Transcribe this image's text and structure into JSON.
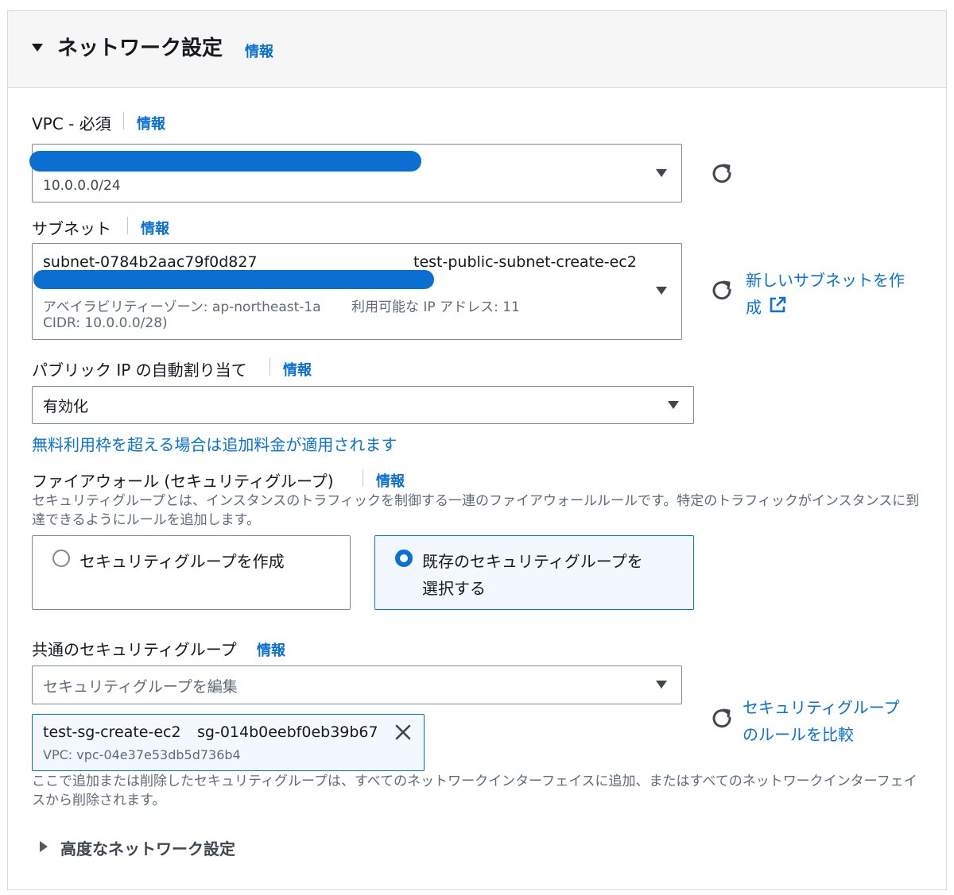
{
  "header": {
    "title": "ネットワーク設定",
    "info": "情報"
  },
  "vpc": {
    "label": "VPC - 必須",
    "info": "情報",
    "cidr": "10.0.0.0/24"
  },
  "subnet": {
    "label": "サブネット",
    "info": "情報",
    "id": "subnet-0784b2aac79f0d827",
    "name": "test-public-subnet-create-ec2",
    "az": "アベイラビリティーゾーン: ap-northeast-1a",
    "ip_available": "利用可能な IP アドレス: 11",
    "cidr": "CIDR: 10.0.0.0/28)",
    "create_link_line1": "新しいサブネットを作",
    "create_link_line2": "成"
  },
  "public_ip": {
    "label": "パブリック IP の自動割り当て",
    "info": "情報",
    "value": "有効化",
    "warning": "無料利用枠を超える場合は追加料金が適用されます"
  },
  "firewall": {
    "label": "ファイアウォール (セキュリティグループ)",
    "info": "情報",
    "description": "セキュリティグループとは、インスタンスのトラフィックを制御する一連のファイアウォールルールです。特定のトラフィックがインスタンスに到達できるようにルールを追加します。",
    "option_create": "セキュリティグループを作成",
    "option_existing_line1": "既存のセキュリティグループを",
    "option_existing_line2": "選択する",
    "selected": "existing"
  },
  "common_sg": {
    "label": "共通のセキュリティグループ",
    "info": "情報",
    "placeholder": "セキュリティグループを編集",
    "token_name": "test-sg-create-ec2",
    "token_id": "sg-014b0eebf0eb39b67",
    "token_vpc": "VPC: vpc-04e37e53db5d736b4",
    "compare_link_line1": "セキュリティグループ",
    "compare_link_line2": "のルールを比較",
    "note": "ここで追加または削除したセキュリティグループは、すべてのネットワークインターフェイスに追加、またはすべてのネットワークインターフェイスから削除されます。"
  },
  "advanced": {
    "label": "高度なネットワーク設定"
  },
  "colors": {
    "link": "#0972d3",
    "border": "#7d8998",
    "selected_bg": "#f2f8fd",
    "redaction": "#0a6fd0"
  }
}
